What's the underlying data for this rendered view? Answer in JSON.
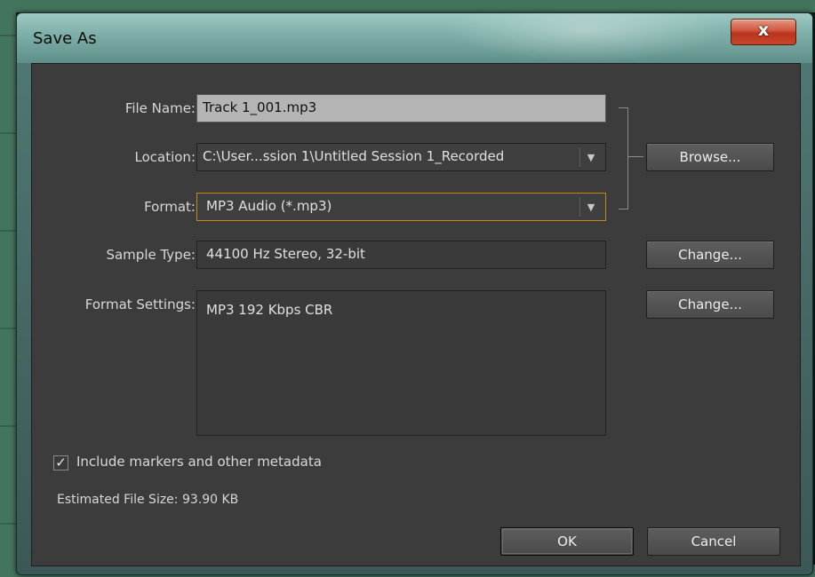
{
  "dialog": {
    "title": "Save As",
    "close_glyph": "x"
  },
  "fields": {
    "file_name": {
      "label": "File Name:",
      "value": "Track 1_001.mp3"
    },
    "location": {
      "label": "Location:",
      "value": "C:\\User...ssion 1\\Untitled Session 1_Recorded"
    },
    "format": {
      "label": "Format:",
      "value": "MP3 Audio (*.mp3)"
    },
    "sample_type": {
      "label": "Sample Type:",
      "value": "44100 Hz Stereo, 32-bit"
    },
    "format_settings": {
      "label": "Format Settings:",
      "value": "MP3 192 Kbps CBR"
    }
  },
  "buttons": {
    "browse": "Browse...",
    "change_sample": "Change...",
    "change_format": "Change...",
    "ok": "OK",
    "cancel": "Cancel"
  },
  "options": {
    "include_markers": {
      "label": "Include markers and other metadata",
      "checked": true,
      "check_glyph": "✓"
    }
  },
  "estimated_size": "Estimated File Size: 93.90 KB",
  "icons": {
    "dropdown": "chevron-down-icon",
    "close": "close-icon",
    "checkbox": "checkbox-checked-icon"
  },
  "colors": {
    "dialog_bg": "#3c3c3c",
    "focus_border": "#c08a1a",
    "close_button": "#c9452a"
  }
}
